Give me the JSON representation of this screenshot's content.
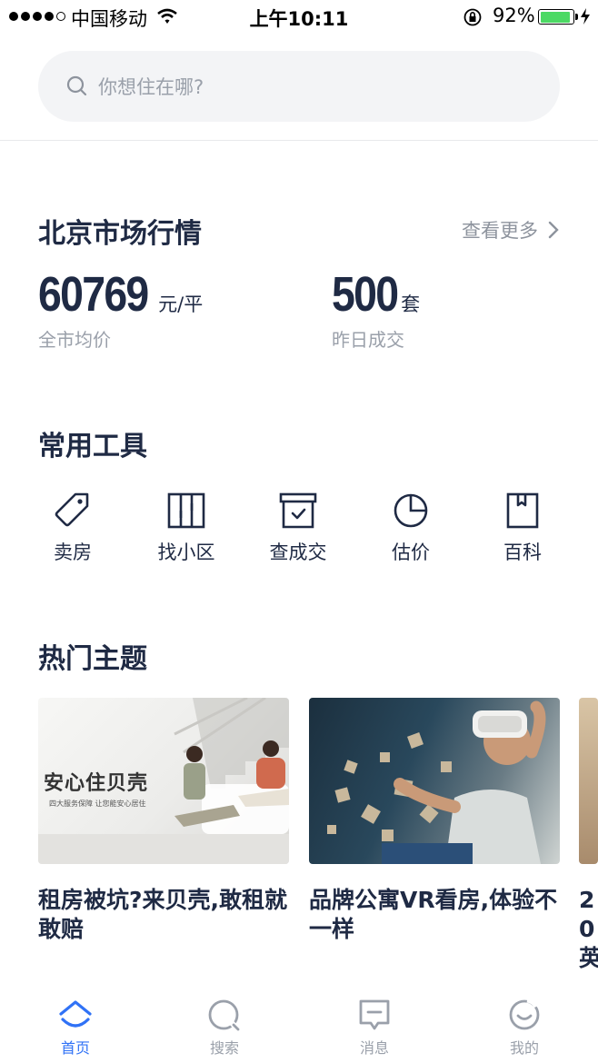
{
  "status_bar": {
    "carrier": "中国移动",
    "time": "上午10:11",
    "battery": "92%"
  },
  "search": {
    "placeholder": "你想住在哪?"
  },
  "market": {
    "title": "北京市场行情",
    "more": "查看更多",
    "stats": [
      {
        "value": "60769",
        "unit": "元/平",
        "label": "全市均价"
      },
      {
        "value": "500",
        "unit": "套",
        "label": "昨日成交"
      }
    ]
  },
  "tools": {
    "title": "常用工具",
    "items": [
      {
        "label": "卖房",
        "icon": "tag-icon"
      },
      {
        "label": "找小区",
        "icon": "map-icon"
      },
      {
        "label": "查成交",
        "icon": "archive-icon"
      },
      {
        "label": "估价",
        "icon": "pie-chart-icon"
      },
      {
        "label": "百科",
        "icon": "book-icon"
      }
    ]
  },
  "topics": {
    "title": "热门主题",
    "cards": [
      {
        "title": "租房被坑?来贝壳,敢租就敢赔",
        "image_text": "安心住贝壳",
        "image_subtext": "四大服务保障  让您能安心居住"
      },
      {
        "title": "品牌公寓VR看房,体验不一样"
      },
      {
        "title": "20英"
      }
    ]
  },
  "tab_bar": {
    "active_color": "#3072f6",
    "items": [
      {
        "label": "首页",
        "icon": "home-icon"
      },
      {
        "label": "搜索",
        "icon": "search-icon"
      },
      {
        "label": "消息",
        "icon": "message-icon"
      },
      {
        "label": "我的",
        "icon": "profile-icon"
      }
    ]
  }
}
